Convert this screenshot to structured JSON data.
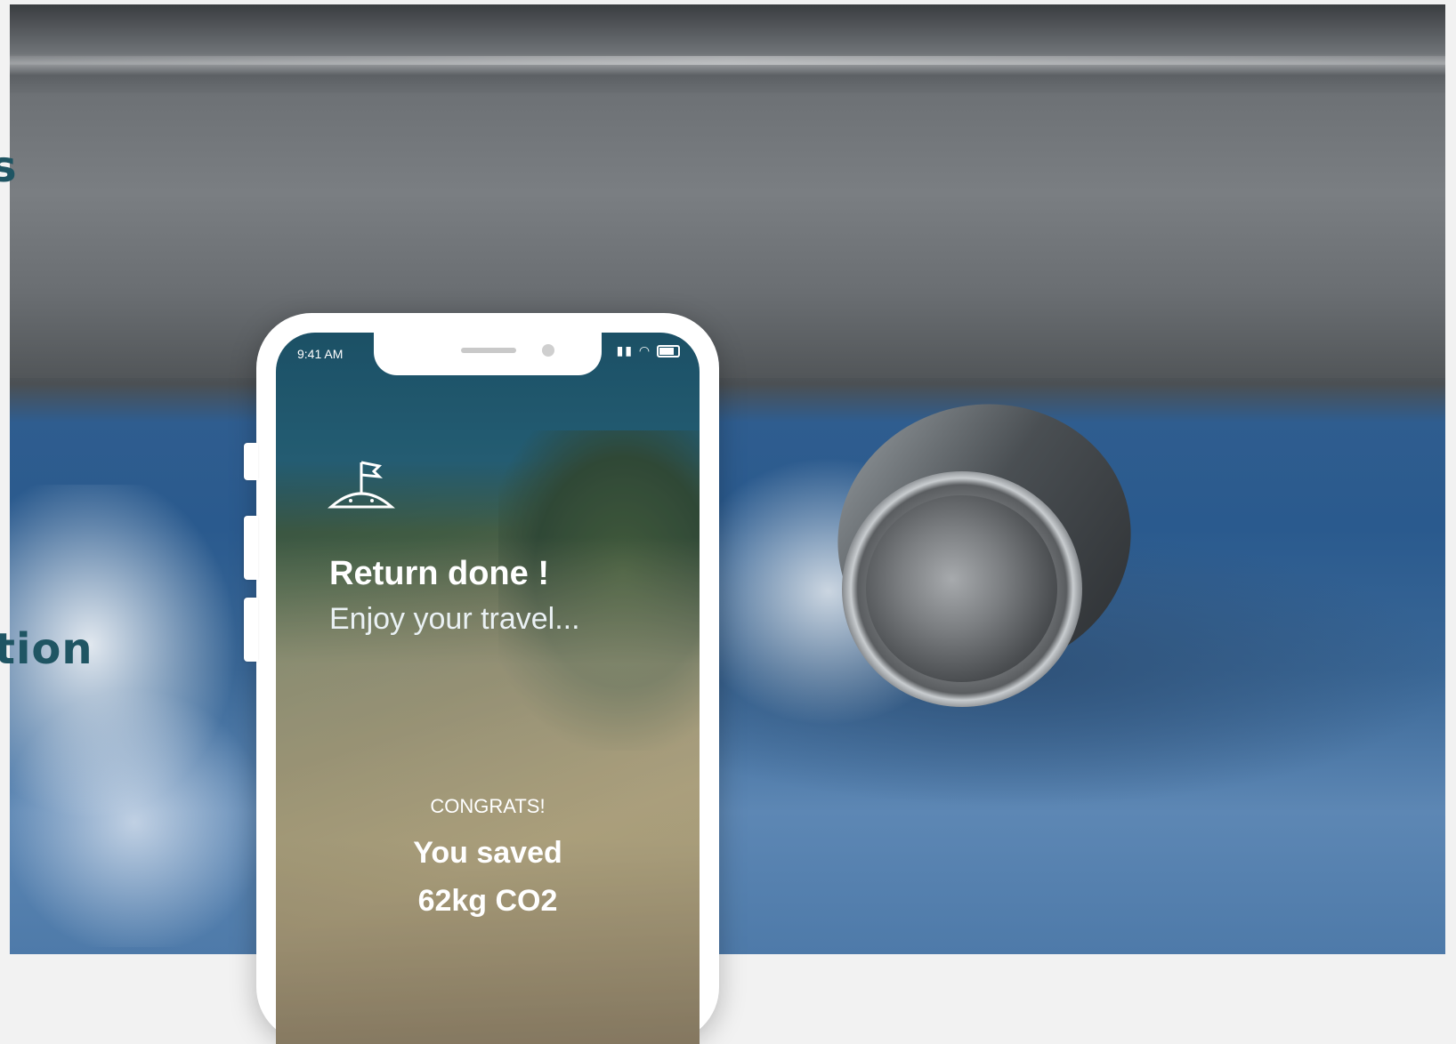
{
  "left_headings": {
    "line1": "s",
    "line2": "tion"
  },
  "phone": {
    "status": {
      "time": "9:41 AM"
    },
    "screen": {
      "title": "Return done !",
      "subtitle": "Enjoy your travel...",
      "congrats": "CONGRATS!",
      "saved_label": "You saved",
      "saved_amount": "62kg CO2"
    },
    "icons": [
      "flag-icon",
      "signal-icon",
      "wifi-icon",
      "battery-icon"
    ]
  },
  "colors": {
    "heading_text": "#1f5563",
    "phone_frame": "#ffffff",
    "page_background": "#f2f2f2"
  }
}
